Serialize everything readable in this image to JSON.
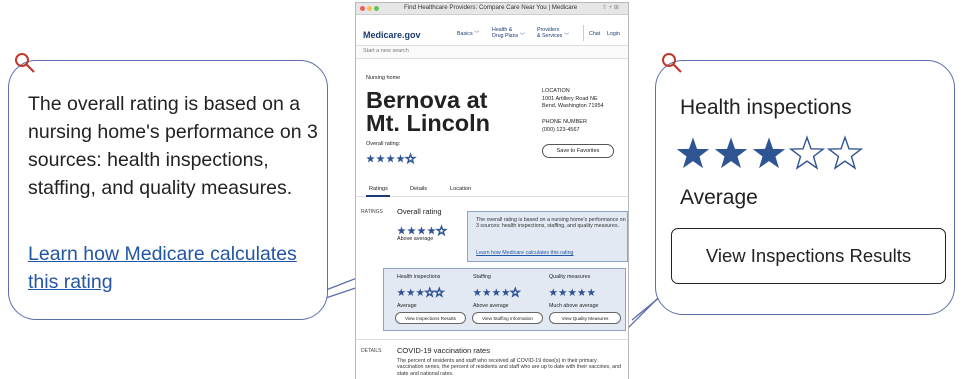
{
  "callouts": {
    "left": {
      "text": "The overall rating is based on a nursing home's performance on 3 sources: health inspections, staffing, and quality measures.",
      "link": "Learn how Medicare calculates this rating"
    },
    "right": {
      "title": "Health inspections",
      "rating_stars": 3,
      "max_stars": 5,
      "rating_label": "Average",
      "button": "View Inspections Results"
    }
  },
  "browser": {
    "window_title": "Find Healthcare Providers: Compare Care Near You | Medicare",
    "logo": "Medicare.gov",
    "nav": {
      "basics": "Basics",
      "health_line1": "Health &",
      "health_line2": "Drug Plans",
      "providers_line1": "Providers",
      "providers_line2": "& Services",
      "chat": "Chat",
      "login": "Login"
    },
    "search_placeholder": "Start a new search",
    "facility_type": "Nursing home",
    "facility_name": "Bernova at Mt. Lincoln",
    "location_label": "LOCATION",
    "address_line1": "1001 Artillery Road NE",
    "address_line2": "Bend, Washington 71954",
    "phone_label": "PHONE NUMBER",
    "phone": "(000) 123-4567",
    "overall_rating_label": "Overall rating:",
    "overall_rating_stars": 4,
    "save_button": "Save to Favorites",
    "tabs": [
      "Ratings",
      "Details",
      "Location"
    ],
    "ratings_section_label": "RATINGS",
    "overall_rating_heading": "Overall rating",
    "overall_rating_text": "Above average",
    "tooltip_text": "The overall rating is based on a nursing home's performance on 3 sources: health inspections, staffing, and quality measures.",
    "tooltip_link": "Learn how Medicare calculates this rating",
    "subratings": [
      {
        "title": "Health inspections",
        "stars": 3,
        "label": "Average",
        "button": "View Inspections Results"
      },
      {
        "title": "Staffing",
        "stars": 4,
        "label": "Above average",
        "button": "View Staffing Information"
      },
      {
        "title": "Quality measures",
        "stars": 5,
        "label": "Much above average",
        "button": "View Quality Measures"
      }
    ],
    "details_section_label": "DETAILS",
    "covid_heading": "COVID-19 vaccination rates",
    "covid_text": "The percent of residents and staff who received all COVID-19 dose(s) in their primary vaccination series, the percent of residents and staff who are up to date with their vaccines, and state and national rates."
  },
  "colors": {
    "accent": "#2f5494",
    "callout_border": "#5b6fa8",
    "link": "#2255a4",
    "highlight_fill": "#e3e9f3",
    "magnifier": "#c0392b"
  }
}
